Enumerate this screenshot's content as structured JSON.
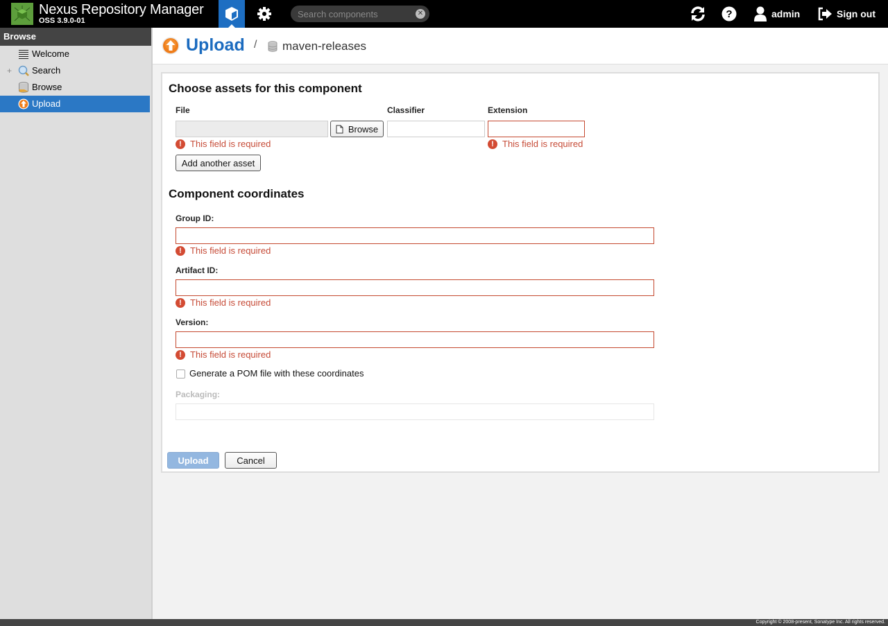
{
  "header": {
    "app_title": "Nexus Repository Manager",
    "version": "OSS 3.9.0-01",
    "search_placeholder": "Search components",
    "search_value": "",
    "user": "admin",
    "sign_out": "Sign out",
    "icons": {
      "logo": "nexus-logo-icon",
      "browse": "cube-icon",
      "admin": "gear-icon",
      "refresh": "refresh-icon",
      "help": "help-icon",
      "user": "user-icon",
      "sign_out": "sign-out-icon",
      "search_clear": "clear-icon"
    },
    "accent": "#1d6ec2"
  },
  "sidebar": {
    "header": "Browse",
    "items": [
      {
        "label": "Welcome",
        "icon": "list-icon",
        "selected": false
      },
      {
        "label": "Search",
        "icon": "magnifier-icon",
        "selected": false,
        "expandable": true,
        "expander": "+"
      },
      {
        "label": "Browse",
        "icon": "database-icon",
        "selected": false
      },
      {
        "label": "Upload",
        "icon": "upload-icon",
        "selected": true
      }
    ],
    "selected_color": "#2b78c5"
  },
  "page": {
    "title": "Upload",
    "breadcrumb_separator": "/",
    "repository": "maven-releases"
  },
  "form": {
    "assets_section_title": "Choose assets for this component",
    "file_label": "File",
    "file_value": "",
    "browse_button": "Browse",
    "classifier_label": "Classifier",
    "classifier_value": "",
    "extension_label": "Extension",
    "extension_value": "",
    "add_asset_button": "Add another asset",
    "coordinates_section_title": "Component coordinates",
    "group_id_label": "Group ID:",
    "group_id_value": "",
    "artifact_id_label": "Artifact ID:",
    "artifact_id_value": "",
    "version_label": "Version:",
    "version_value": "",
    "generate_pom_label": "Generate a POM file with these coordinates",
    "generate_pom_checked": false,
    "packaging_label": "Packaging:",
    "packaging_value": "",
    "error_message": "This field is required",
    "upload_button": "Upload",
    "cancel_button": "Cancel",
    "error_color": "#c64a36"
  },
  "footer": {
    "copyright": "Copyright © 2008-present, Sonatype Inc. All rights reserved."
  }
}
